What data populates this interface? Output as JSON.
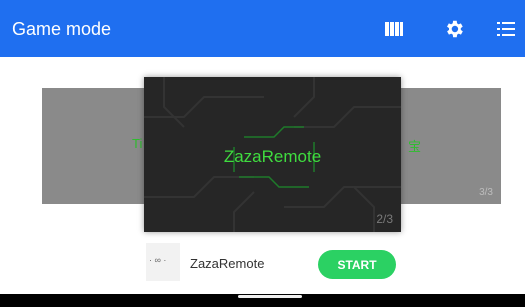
{
  "app_bar": {
    "title": "Game mode",
    "icons": [
      "grid-view-icon",
      "settings-gear-icon",
      "menu-list-icon"
    ],
    "color": "#1f6ff0"
  },
  "carousel": {
    "left_card": {
      "peek_text": "Ti",
      "page": ""
    },
    "center_card": {
      "title": "ZazaRemote",
      "page": "2/3",
      "text_color": "#3fdc3f"
    },
    "right_card": {
      "peek_text": "宝",
      "page": "3/3"
    }
  },
  "selected_app": {
    "thumbnail_text": "· ∞ ·",
    "name": "ZazaRemote"
  },
  "start_button": {
    "label": "START",
    "color": "#2bd163"
  }
}
